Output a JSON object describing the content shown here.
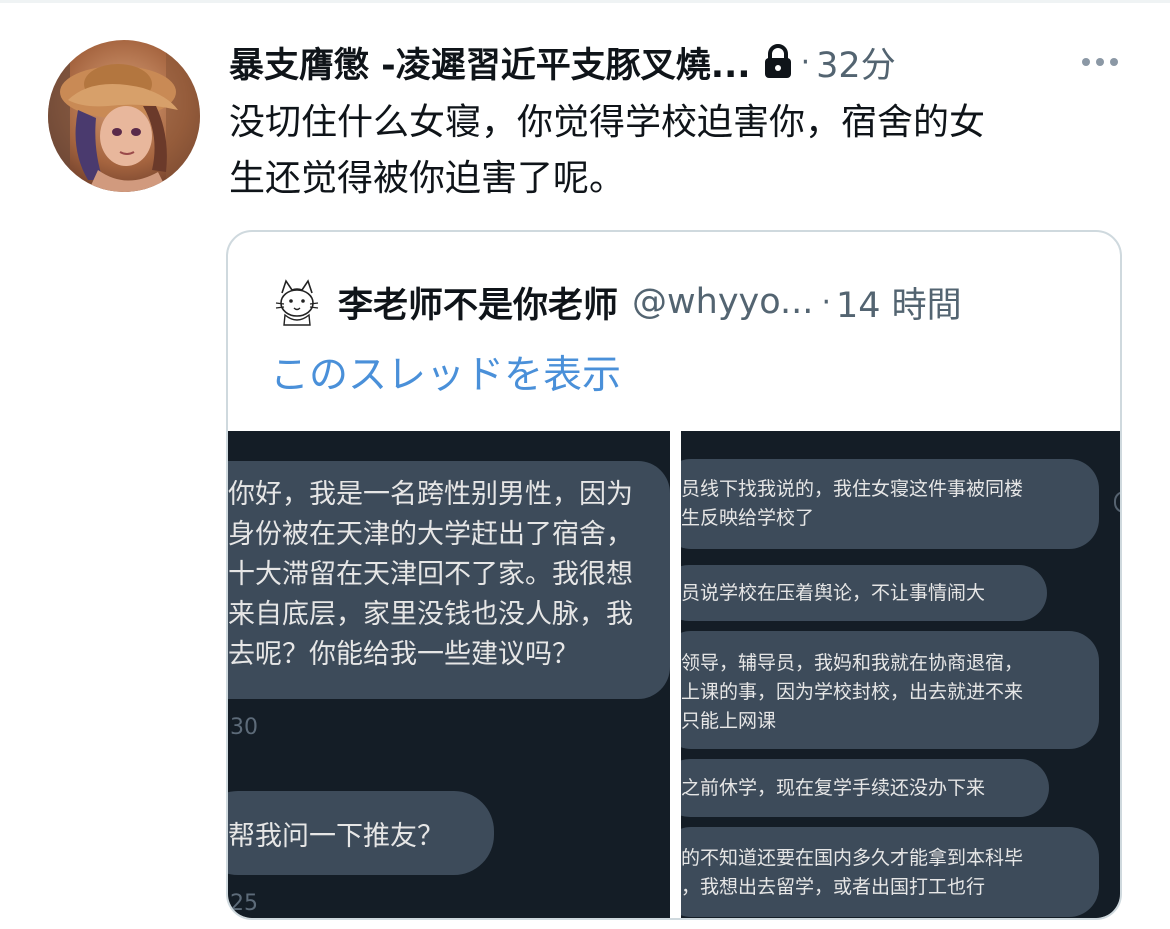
{
  "tweet": {
    "display_name": "暴支膺懲 -凌遲習近平支豚叉燒...",
    "protected_icon": "lock-icon",
    "separator": "·",
    "time": "32分",
    "more_icon": "more-horizontal-icon",
    "text_line1": "没切住什么女寝，你觉得学校迫害你，宿舍的女",
    "text_line2": "生还觉得被你迫害了呢。"
  },
  "quote": {
    "display_name": "李老师不是你老师",
    "handle": "@whyyo...",
    "separator": "·",
    "time": "14 時間",
    "show_thread": "このスレッドを表示",
    "left_panel": {
      "message1_lines": [
        "你好，我是一名跨性别男性，因为",
        "身份被在天津的大学赶出了宿舍，",
        "十大滞留在天津回不了家。我很想",
        "来自底层，家里没钱也没人脉，我",
        "去呢？你能给我一些建议吗？"
      ],
      "timestamp1": "30",
      "message2": "帮我问一下推友？",
      "timestamp2": "25"
    },
    "right_panel": {
      "message1_lines": [
        "员线下找我说的，我住女寝这件事被同楼",
        "生反映给学校了"
      ],
      "message2": "员说学校在压着舆论，不让事情闹大",
      "message3_lines": [
        "领导，辅导员，我妈和我就在协商退宿，",
        "上课的事，因为学校封校，出去就进不来",
        "只能上网课"
      ],
      "message4": "之前休学，现在复学手续还没办下来",
      "message5_lines": [
        "的不知道还要在国内多久才能拿到本科毕",
        "，我想出去留学，或者出国打工也行"
      ]
    }
  },
  "colors": {
    "text_primary": "#0f1419",
    "text_secondary": "#536471",
    "link_blue": "#4a90d9",
    "chat_background": "#141d26",
    "chat_bubble": "#3d4b5a",
    "card_border": "#cfd9de"
  }
}
